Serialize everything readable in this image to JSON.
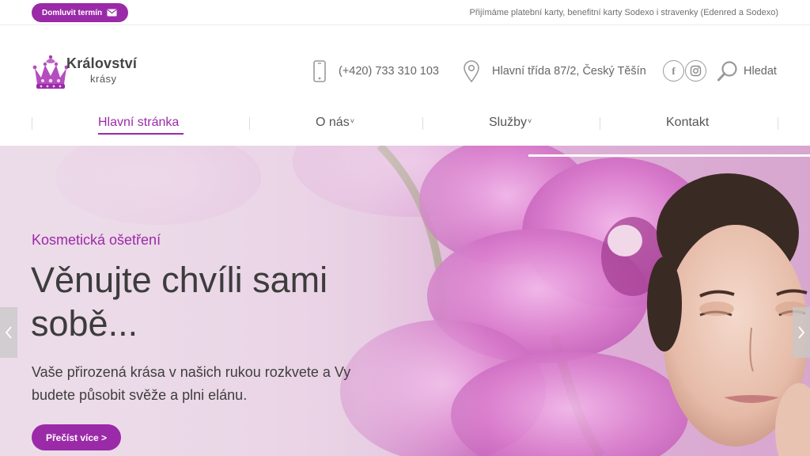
{
  "topbar": {
    "book_label": "Domluvit termín",
    "payments_note": "Přijímáme platební karty, benefitní karty Sodexo i stravenky (Edenred a Sodexo)"
  },
  "logo": {
    "title": "Království",
    "subtitle": "krásy"
  },
  "contact": {
    "phone": "(+420) 733 310 103",
    "address": "Hlavní třída 87/2, Český Těšín"
  },
  "search": {
    "label": "Hledat"
  },
  "nav": {
    "items": [
      {
        "label": "Hlavní stránka",
        "active": true
      },
      {
        "label": "O nás",
        "caret": "˅"
      },
      {
        "label": "Služby",
        "caret": "˅"
      },
      {
        "label": "Kontakt"
      }
    ]
  },
  "hero": {
    "eyebrow": "Kosmetická ošetření",
    "title": "Věnujte chvíli sami sobě...",
    "text": "Vaše přirozená krása v našich rukou rozkvete a Vy budete působit svěže a plni elánu.",
    "button": "Přečíst více >"
  },
  "colors": {
    "brand": "#9b2aa8",
    "text": "#555555",
    "hero_bg": "#e3c0dc"
  },
  "icons": [
    "envelope-icon",
    "crown-logo-icon",
    "phone-icon",
    "map-pin-icon",
    "facebook-icon",
    "instagram-icon",
    "search-icon",
    "chevron-left-icon",
    "chevron-right-icon"
  ]
}
